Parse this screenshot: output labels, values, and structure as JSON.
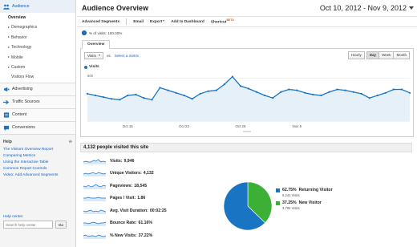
{
  "sidebar": {
    "audience_label": "Audience",
    "audience_items": [
      {
        "label": "Overview",
        "selected": true,
        "arrow": false
      },
      {
        "label": "Demographics",
        "arrow": true
      },
      {
        "label": "Behavior",
        "arrow": true
      },
      {
        "label": "Technology",
        "arrow": true
      },
      {
        "label": "Mobile",
        "arrow": true
      },
      {
        "label": "Custom",
        "arrow": true
      },
      {
        "label": "Visitors Flow",
        "arrow": false
      }
    ],
    "sections": [
      "Advertising",
      "Traffic Sources",
      "Content",
      "Conversions"
    ],
    "help_title": "Help",
    "help_links": [
      "The Visitors Overview Report",
      "Comparing Metrics",
      "Using the Interactive Table",
      "Common Report Controls",
      "Video: Add Advanced Segments"
    ],
    "help_center_label": "Help center",
    "help_search_placeholder": "Search help center",
    "help_go": "Go"
  },
  "header": {
    "title": "Audience Overview",
    "date_range": "Oct 10, 2012 - Nov 9, 2012"
  },
  "toolbar": {
    "advanced_segments": "Advanced Segments",
    "email": "Email",
    "export": "Export",
    "add_to_dashboard": "Add to Dashboard",
    "shortcut": "Shortcut",
    "beta": "BETA"
  },
  "segment": {
    "label": "% of visits: 100.00%"
  },
  "tabs": {
    "overview": "Overview"
  },
  "chart_controls": {
    "metric": "Visits",
    "vs": "vs.",
    "select_metric": "Select a metric",
    "granularity": [
      "Hourly",
      "Day",
      "Week",
      "Month"
    ],
    "selected_granularity": "Day"
  },
  "chart_data": {
    "type": "area",
    "series": [
      {
        "name": "Visits",
        "color": "#1a74c4",
        "values": [
          320,
          300,
          280,
          260,
          250,
          300,
          310,
          270,
          250,
          390,
          360,
          330,
          300,
          260,
          320,
          350,
          360,
          430,
          520,
          410,
          380,
          340,
          300,
          270,
          340,
          370,
          360,
          330,
          310,
          300,
          340,
          370,
          360,
          340,
          320,
          270,
          300,
          330,
          370,
          370,
          330
        ]
      }
    ],
    "y_ticks": [
      500,
      250
    ],
    "ylim": [
      0,
      600
    ],
    "x_tick_labels": [
      "Oct 15",
      "Oct 22",
      "Oct 29",
      "Nov 5"
    ],
    "grid": true
  },
  "overview": {
    "heading": "4,132 people visited this site",
    "metrics": [
      {
        "name": "Visits:",
        "value": "9,946"
      },
      {
        "name": "Unique Visitors:",
        "value": "4,132"
      },
      {
        "name": "Pageviews:",
        "value": "18,545"
      },
      {
        "name": "Pages / Visit:",
        "value": "1.86"
      },
      {
        "name": "Avg. Visit Duration:",
        "value": "00:02:25"
      },
      {
        "name": "Bounce Rate:",
        "value": "61.16%"
      },
      {
        "name": "% New Visits:",
        "value": "37.22%"
      }
    ],
    "pie": [
      {
        "percent": "62.75%",
        "label": "Returning Visitor",
        "sub": "6,241 Visits",
        "value": 62.75,
        "color": "#1a74c4"
      },
      {
        "percent": "37.25%",
        "label": "New Visitor",
        "sub": "3,705 Visits",
        "value": 37.25,
        "color": "#3cb034"
      }
    ]
  }
}
